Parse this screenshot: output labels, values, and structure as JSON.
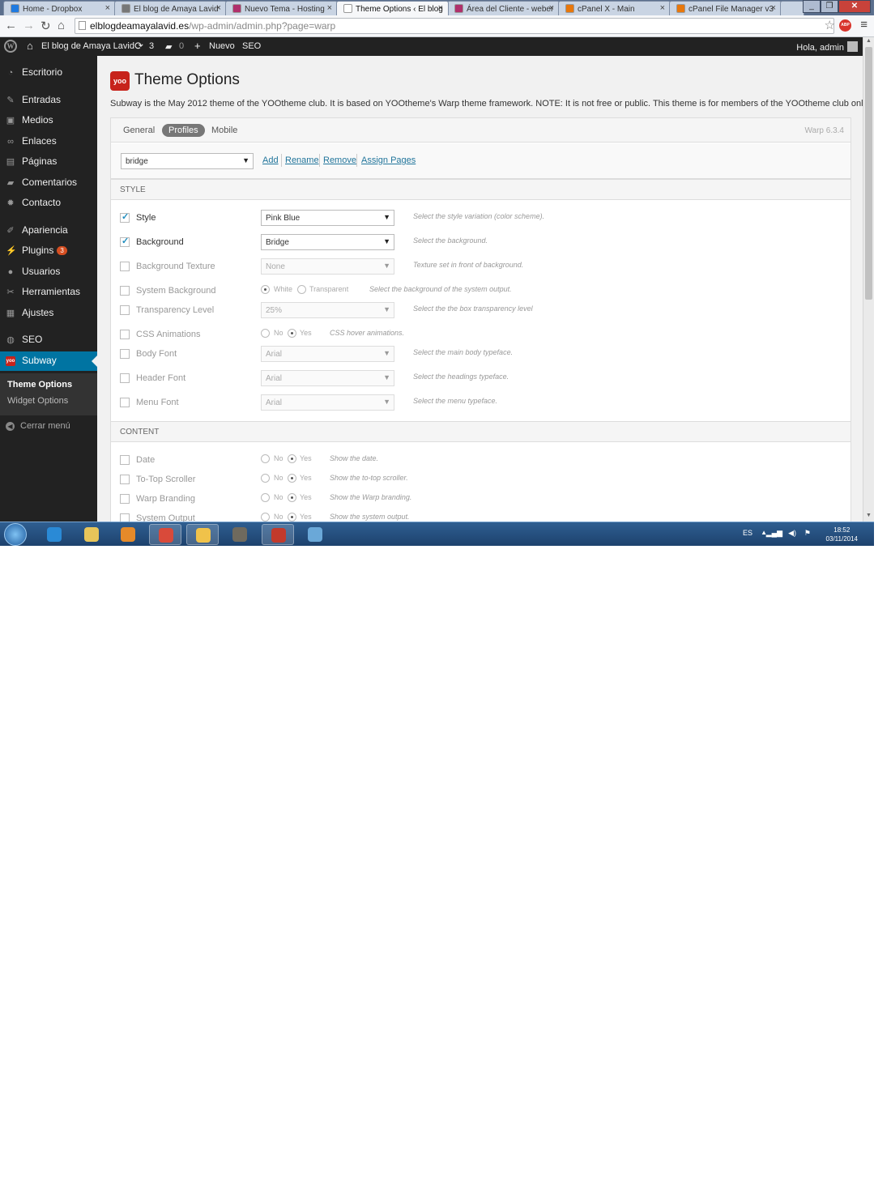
{
  "browser": {
    "tabs": [
      {
        "label": "Home - Dropbox",
        "color": "#1f7ae0"
      },
      {
        "label": "El blog de Amaya Lavid",
        "color": "#777777"
      },
      {
        "label": "Nuevo Tema - Hosting",
        "color": "#b0306c"
      },
      {
        "label": "Theme Options ‹ El blog",
        "color": "#ffffff"
      },
      {
        "label": "Área del Cliente - weber",
        "color": "#b0306c"
      },
      {
        "label": "cPanel X - Main",
        "color": "#e8770b"
      },
      {
        "label": "cPanel File Manager v3",
        "color": "#e8770b"
      }
    ],
    "active_tab": 3,
    "url_domain": "elblogdeamayalavid.es",
    "url_path": "/wp-admin/admin.php?page=warp",
    "abp_label": "ABP"
  },
  "adminbar": {
    "site_name": "El blog de Amaya Lavid",
    "updates_count": "3",
    "comments_count": "0",
    "new_label": "Nuevo",
    "seo_label": "SEO",
    "greeting": "Hola, admin"
  },
  "sidebar": {
    "items": [
      {
        "label": "Escritorio",
        "icon": "dashboard-icon",
        "glyph": "◔"
      },
      {
        "label": "Entradas",
        "icon": "pin-icon",
        "glyph": "✎"
      },
      {
        "label": "Medios",
        "icon": "media-icon",
        "glyph": "▣"
      },
      {
        "label": "Enlaces",
        "icon": "link-icon",
        "glyph": "∞"
      },
      {
        "label": "Páginas",
        "icon": "pages-icon",
        "glyph": "▤"
      },
      {
        "label": "Comentarios",
        "icon": "comments-icon",
        "glyph": "▰"
      },
      {
        "label": "Contacto",
        "icon": "gear-icon",
        "glyph": "✹"
      },
      {
        "label": "Apariencia",
        "icon": "brush-icon",
        "glyph": "✐"
      },
      {
        "label": "Plugins",
        "icon": "plugin-icon",
        "glyph": "⚡",
        "badge": "3"
      },
      {
        "label": "Usuarios",
        "icon": "user-icon",
        "glyph": "●"
      },
      {
        "label": "Herramientas",
        "icon": "wrench-icon",
        "glyph": "✂"
      },
      {
        "label": "Ajustes",
        "icon": "settings-icon",
        "glyph": "▦"
      },
      {
        "label": "SEO",
        "icon": "seo-icon",
        "glyph": "◍"
      },
      {
        "label": "Subway",
        "icon": "yoo-icon",
        "glyph": "yoo"
      }
    ],
    "submenu": [
      "Theme Options",
      "Widget Options"
    ],
    "collapse_label": "Cerrar menú"
  },
  "page": {
    "logo_text": "yoo",
    "title": "Theme Options",
    "description": "Subway is the May 2012 theme of the YOOtheme club. It is based on YOOtheme's Warp theme framework. NOTE: It is not free or public. This theme is for members of the YOOtheme club only.",
    "tabs": [
      "General",
      "Profiles",
      "Mobile"
    ],
    "active_tab": 1,
    "version": "Warp 6.3.4",
    "profile_value": "bridge",
    "profile_actions": [
      "Add",
      "Rename",
      "Remove",
      "Assign Pages"
    ]
  },
  "style_section": {
    "title": "STYLE",
    "rows": [
      {
        "label": "Style",
        "checked": true,
        "type": "select",
        "value": "Pink Blue",
        "help": "Select the style variation (color scheme)."
      },
      {
        "label": "Background",
        "checked": true,
        "type": "select",
        "value": "Bridge",
        "help": "Select the background."
      },
      {
        "label": "Background Texture",
        "checked": false,
        "type": "select",
        "value": "None",
        "help": "Texture set in front of background."
      },
      {
        "label": "System Background",
        "checked": false,
        "type": "radio",
        "options": [
          "White",
          "Transparent"
        ],
        "selected": 0,
        "help": "Select the background of the system output."
      },
      {
        "label": "Transparency Level",
        "checked": false,
        "type": "select",
        "value": "25%",
        "help": "Select the the box transparency level"
      },
      {
        "label": "CSS Animations",
        "checked": false,
        "type": "radio",
        "options": [
          "No",
          "Yes"
        ],
        "selected": 1,
        "help": "CSS hover animations."
      },
      {
        "label": "Body Font",
        "checked": false,
        "type": "select",
        "value": "Arial",
        "help": "Select the main body typeface."
      },
      {
        "label": "Header Font",
        "checked": false,
        "type": "select",
        "value": "Arial",
        "help": "Select the headings typeface."
      },
      {
        "label": "Menu Font",
        "checked": false,
        "type": "select",
        "value": "Arial",
        "help": "Select the menu typeface."
      }
    ]
  },
  "content_section": {
    "title": "CONTENT",
    "rows": [
      {
        "label": "Date",
        "checked": false,
        "type": "radio",
        "options": [
          "No",
          "Yes"
        ],
        "selected": 1,
        "help": "Show the date."
      },
      {
        "label": "To-Top Scroller",
        "checked": false,
        "type": "radio",
        "options": [
          "No",
          "Yes"
        ],
        "selected": 1,
        "help": "Show the to-top scroller."
      },
      {
        "label": "Warp Branding",
        "checked": false,
        "type": "radio",
        "options": [
          "No",
          "Yes"
        ],
        "selected": 1,
        "help": "Show the Warp branding."
      },
      {
        "label": "System Output",
        "checked": false,
        "type": "radio",
        "options": [
          "No",
          "Yes"
        ],
        "selected": 1,
        "help": "Show the system output."
      }
    ]
  },
  "taskbar": {
    "apps": [
      {
        "name": "ie-icon",
        "color": "#2a8ad6",
        "pinned": false
      },
      {
        "name": "explorer-icon",
        "color": "#e7c55a",
        "pinned": false
      },
      {
        "name": "media-player-icon",
        "color": "#e58a2a",
        "pinned": false
      },
      {
        "name": "chrome-icon",
        "color": "#d94a3a",
        "pinned": true
      },
      {
        "name": "outlook-icon",
        "color": "#f0c24a",
        "pinned": true
      },
      {
        "name": "gimp-icon",
        "color": "#6f6a5e",
        "pinned": false
      },
      {
        "name": "filezilla-icon",
        "color": "#c23a2c",
        "pinned": true
      },
      {
        "name": "tweetdeck-icon",
        "color": "#6aa8d8",
        "pinned": false
      }
    ],
    "lang": "ES",
    "time": "18:52",
    "date": "03/11/2014"
  }
}
